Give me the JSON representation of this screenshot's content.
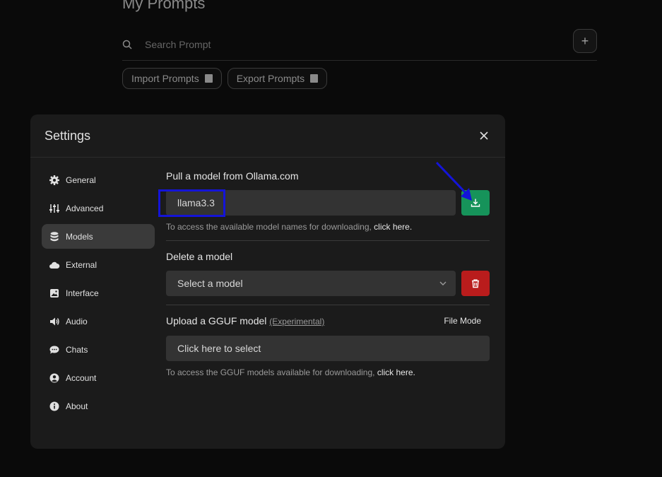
{
  "background": {
    "title": "My Prompts",
    "search_placeholder": "Search Prompt",
    "add_label": "+",
    "import_label": "Import Prompts",
    "export_label": "Export Prompts"
  },
  "settings": {
    "title": "Settings",
    "sidebar": [
      {
        "label": "General",
        "icon": "gear-icon"
      },
      {
        "label": "Advanced",
        "icon": "sliders-icon"
      },
      {
        "label": "Models",
        "icon": "database-icon",
        "active": true
      },
      {
        "label": "External",
        "icon": "cloud-icon"
      },
      {
        "label": "Interface",
        "icon": "image-icon"
      },
      {
        "label": "Audio",
        "icon": "speaker-icon"
      },
      {
        "label": "Chats",
        "icon": "chat-icon"
      },
      {
        "label": "Account",
        "icon": "user-icon"
      },
      {
        "label": "About",
        "icon": "info-icon"
      }
    ],
    "pull": {
      "title": "Pull a model from Ollama.com",
      "value": "llama3.3",
      "hint": "To access the available model names for downloading, ",
      "hint_link": "click here."
    },
    "delete": {
      "title": "Delete a model",
      "placeholder": "Select a model"
    },
    "upload": {
      "title": "Upload a GGUF model",
      "tag": "(Experimental)",
      "mode": "File Mode",
      "select_label": "Click here to select",
      "hint": "To access the GGUF models available for downloading, ",
      "hint_link": "click here."
    }
  },
  "colors": {
    "download_button": "#16935a",
    "delete_button": "#b91c1c",
    "annotation": "#1414d8"
  }
}
